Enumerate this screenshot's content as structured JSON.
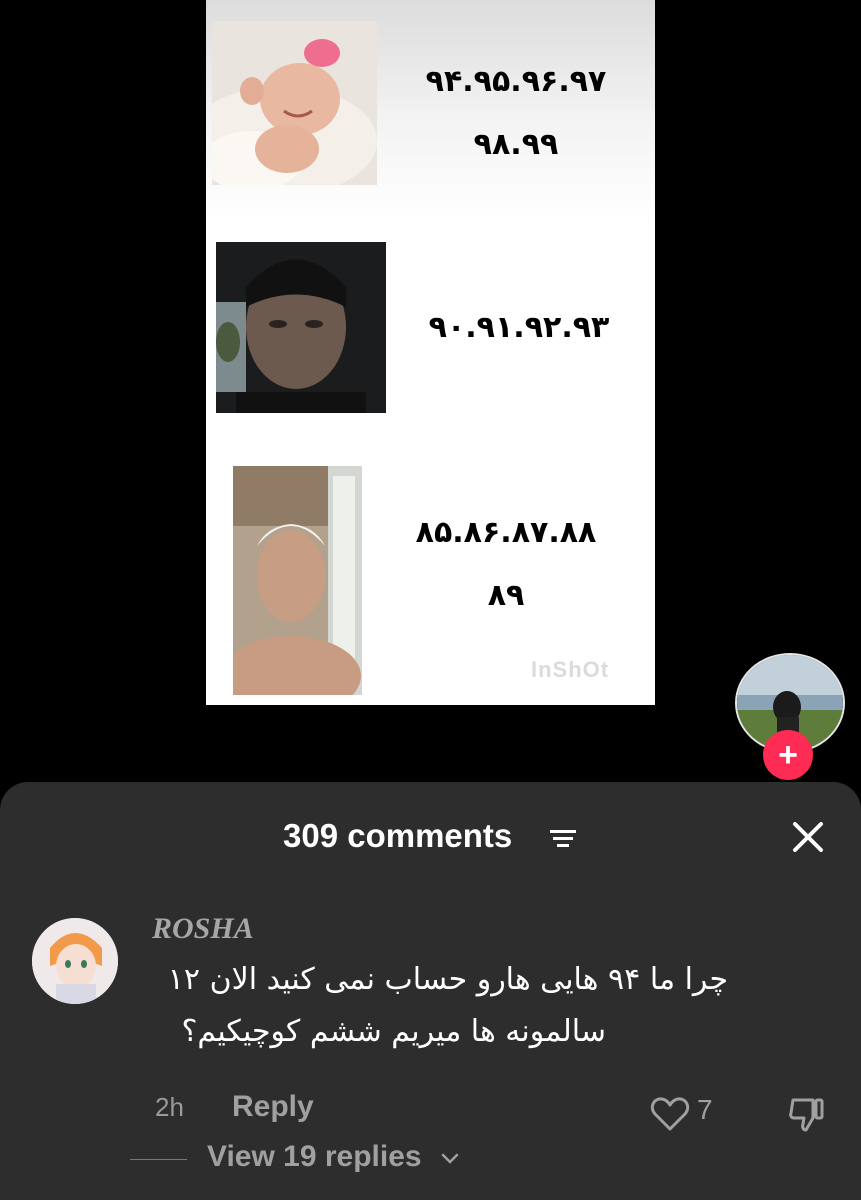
{
  "video": {
    "years_row1_line1": "۹۴.۹۵.۹۶.۹۷",
    "years_row1_line2": "۹۸.۹۹",
    "years_row2": "۹۰.۹۱.۹۲.۹۳",
    "years_row3_line1": "۸۵.۸۶.۸۷.۸۸",
    "years_row3_line2": "۸۹",
    "watermark": "InShOt"
  },
  "creator": {
    "follow_label": "+"
  },
  "comments_sheet": {
    "count_label": "309 comments",
    "comment": {
      "username": "ROSHA",
      "text_line1": "چرا ما ۹۴ هایی هارو حساب نمی کنید الان ۱۲",
      "text_line2": "سالمونه ها میریم ششم کوچیکیم؟",
      "time": "2h",
      "reply_label": "Reply",
      "like_count": "7"
    },
    "view_replies_label": "View 19 replies"
  },
  "icons": {
    "sort": "sort-icon",
    "close": "close-icon",
    "like": "heart-icon",
    "dislike": "thumbs-down-icon",
    "expand": "chevron-down-icon"
  },
  "colors": {
    "accent": "#fe2c55",
    "sheet_bg": "#2d2d2d",
    "muted_text": "#a0a0a0"
  }
}
